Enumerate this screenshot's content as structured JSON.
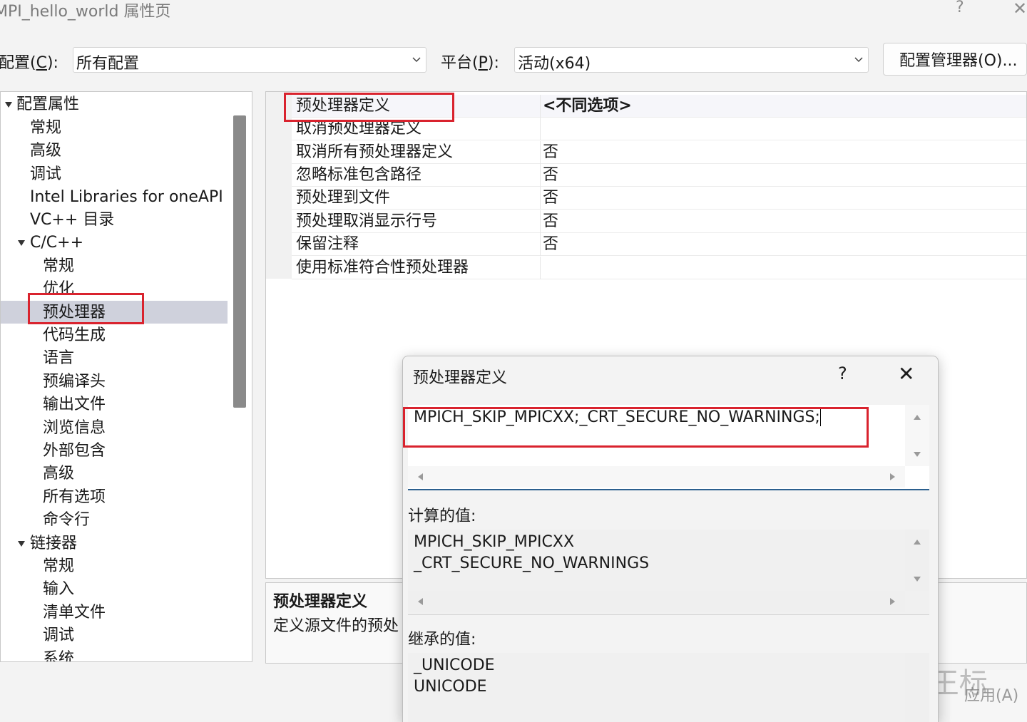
{
  "window": {
    "title": "MPI_hello_world 属性页",
    "help_glyph": "?",
    "close_glyph": "✕"
  },
  "toolbar": {
    "config_label_pre": "配置(",
    "config_label_key": "C",
    "config_label_post": "):",
    "config_value": "所有配置",
    "platform_label_pre": "平台(",
    "platform_label_key": "P",
    "platform_label_post": "):",
    "platform_value": "活动(x64)",
    "manager_button": "配置管理器(O)..."
  },
  "tree": {
    "items": [
      {
        "label": "配置属性"
      },
      {
        "label": "常规"
      },
      {
        "label": "高级"
      },
      {
        "label": "调试"
      },
      {
        "label": "Intel Libraries for oneAPI"
      },
      {
        "label": "VC++ 目录"
      },
      {
        "label": "C/C++"
      },
      {
        "label": "常规"
      },
      {
        "label": "优化"
      },
      {
        "label": "预处理器"
      },
      {
        "label": "代码生成"
      },
      {
        "label": "语言"
      },
      {
        "label": "预编译头"
      },
      {
        "label": "输出文件"
      },
      {
        "label": "浏览信息"
      },
      {
        "label": "外部包含"
      },
      {
        "label": "高级"
      },
      {
        "label": "所有选项"
      },
      {
        "label": "命令行"
      },
      {
        "label": "链接器"
      },
      {
        "label": "常规"
      },
      {
        "label": "输入"
      },
      {
        "label": "清单文件"
      },
      {
        "label": "调试"
      },
      {
        "label": "系统"
      }
    ]
  },
  "grid": {
    "rows": [
      {
        "name": "预处理器定义",
        "value": "<不同选项>"
      },
      {
        "name": "取消预处理器定义",
        "value": ""
      },
      {
        "name": "取消所有预处理器定义",
        "value": "否"
      },
      {
        "name": "忽略标准包含路径",
        "value": "否"
      },
      {
        "name": "预处理到文件",
        "value": "否"
      },
      {
        "name": "预处理取消显示行号",
        "value": "否"
      },
      {
        "name": "保留注释",
        "value": "否"
      },
      {
        "name": "使用标准符合性预处理器",
        "value": ""
      }
    ]
  },
  "description": {
    "title": "预处理器定义",
    "text": "定义源文件的预处"
  },
  "dialog": {
    "title": "预处理器定义",
    "help_glyph": "?",
    "close_glyph": "✕",
    "edit_value": "MPICH_SKIP_MPICXX;_CRT_SECURE_NO_WARNINGS;",
    "computed_label": "计算的值:",
    "computed_lines": [
      "MPICH_SKIP_MPICXX",
      "_CRT_SECURE_NO_WARNINGS"
    ],
    "inherited_label": "继承的值:",
    "inherited_lines": [
      "_UNICODE",
      "UNICODE"
    ]
  },
  "footer": {
    "apply_button": "应用(A)",
    "watermark": "知乎 @王标"
  },
  "colors": {
    "highlight_box": "#d9232e",
    "tree_selection": "#cfd1dc",
    "edit_underline": "#2b5f8e"
  }
}
